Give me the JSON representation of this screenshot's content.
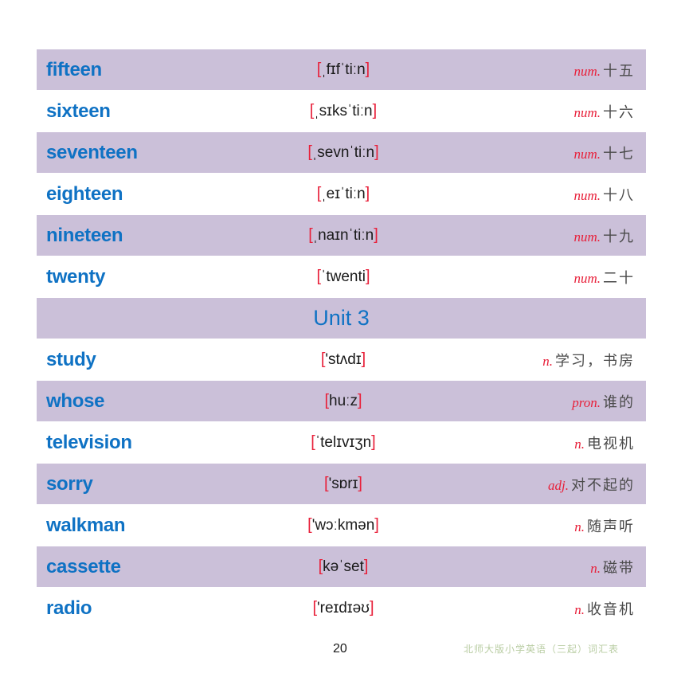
{
  "rows": [
    {
      "type": "entry",
      "word": "fifteen",
      "phonetic": "ˌfɪfˈtiːn",
      "pos": "num.",
      "meaning": "十五"
    },
    {
      "type": "entry",
      "word": "sixteen",
      "phonetic": "ˌsɪksˈtiːn",
      "pos": "num.",
      "meaning": "十六"
    },
    {
      "type": "entry",
      "word": "seventeen",
      "phonetic": "ˌsevnˈtiːn",
      "pos": "num.",
      "meaning": "十七"
    },
    {
      "type": "entry",
      "word": "eighteen",
      "phonetic": "ˌeɪˈtiːn",
      "pos": "num.",
      "meaning": "十八"
    },
    {
      "type": "entry",
      "word": "nineteen",
      "phonetic": "ˌnaɪnˈtiːn",
      "pos": "num.",
      "meaning": "十九"
    },
    {
      "type": "entry",
      "word": "twenty",
      "phonetic": "ˈtwenti",
      "pos": "num.",
      "meaning": "二十"
    },
    {
      "type": "unit",
      "label": "Unit 3"
    },
    {
      "type": "entry",
      "word": "study",
      "phonetic": "'stʌdɪ",
      "pos": "n.",
      "meaning": "学习，书房"
    },
    {
      "type": "entry",
      "word": "whose",
      "phonetic": "huːz",
      "pos": "pron.",
      "meaning": "谁的"
    },
    {
      "type": "entry",
      "word": "television",
      "phonetic": "ˈtelɪvɪʒn",
      "pos": "n.",
      "meaning": "电视机"
    },
    {
      "type": "entry",
      "word": "sorry",
      "phonetic": "'sɒrɪ",
      "pos": "adj.",
      "meaning": "对不起的"
    },
    {
      "type": "entry",
      "word": "walkman",
      "phonetic": "'wɔːkmən",
      "pos": "n.",
      "meaning": "随声听"
    },
    {
      "type": "entry",
      "word": "cassette",
      "phonetic": "kəˈset",
      "pos": "n.",
      "meaning": "磁带"
    },
    {
      "type": "entry",
      "word": "radio",
      "phonetic": "'reɪdɪəʊ",
      "pos": "n.",
      "meaning": "收音机"
    }
  ],
  "footer": {
    "page_number": "20",
    "book_title": "北师大版小学英语（三起）词汇表"
  },
  "colors": {
    "row_shade": "#cbc0d9",
    "word": "#0f72c4",
    "bracket_pos": "#e8203a",
    "footer_title": "#b9cda3"
  }
}
